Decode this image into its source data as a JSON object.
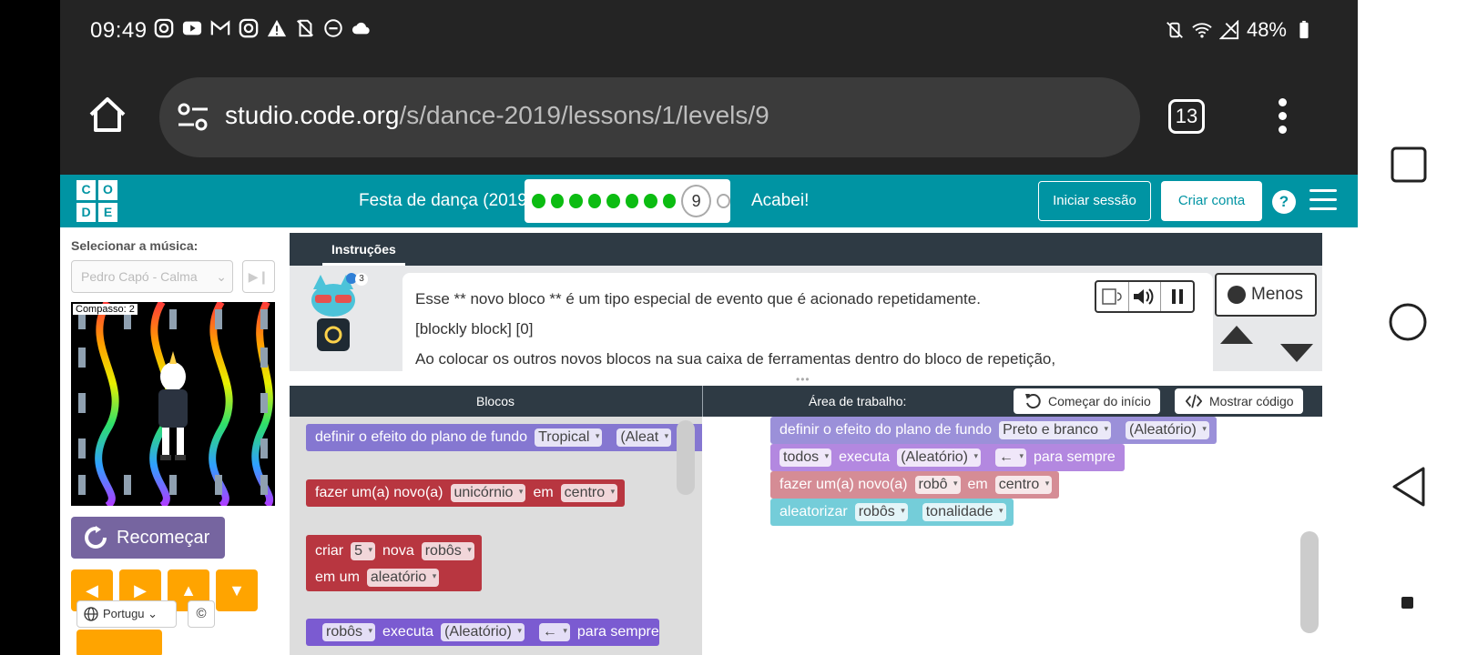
{
  "status_bar": {
    "time": "09:49",
    "battery": "48%",
    "left_icons": [
      "instagram-icon",
      "youtube-icon",
      "gmail-icon",
      "instagram-icon",
      "warning-icon",
      "data-saver-off-icon",
      "dnd-icon",
      "cloud-icon"
    ],
    "right_icons": [
      "vibrate-icon",
      "wifi-icon",
      "signal-icon",
      "battery-icon"
    ]
  },
  "browser": {
    "url_domain": "studio.code.org",
    "url_path": "/s/dance-2019/lessons/1/levels/9",
    "tab_count": "13"
  },
  "header": {
    "logo_letters": [
      "C",
      "O",
      "D",
      "E"
    ],
    "lesson_title": "Festa de dança (2019)",
    "completed_levels": 8,
    "current_level": "9",
    "finish_label": "Acabei!",
    "login_label": "Iniciar sessão",
    "create_account_label": "Criar conta",
    "help_label": "?"
  },
  "music": {
    "label": "Selecionar a música:",
    "selected": "Pedro Capó - Calma",
    "beat_label": "Compasso: 2"
  },
  "controls": {
    "restart_label": "Recomeçar",
    "arrows": [
      "◀",
      "▶",
      "▲",
      "▼"
    ],
    "language": "Portugu",
    "copyright": "©"
  },
  "instructions": {
    "tab_label": "Instruções",
    "hint_count": "3",
    "lines": [
      "Esse ** novo bloco ** é um tipo especial de evento que é acionado repetidamente.",
      "[blockly block] [0]",
      "Ao colocar os outros novos blocos na sua caixa de ferramentas dentro do bloco de repetição,"
    ],
    "less_label": "Menos"
  },
  "workspace_header": {
    "blocks_title": "Blocos",
    "workspace_title": "Área de trabalho:",
    "restart_label": "Começar do início",
    "show_code_label": "Mostrar código"
  },
  "toolbox_blocks": {
    "b1": {
      "text": "definir o efeito do plano de fundo",
      "f1": "Tropical",
      "f2": "(Aleat"
    },
    "b2": {
      "t1": "fazer um(a) novo(a)",
      "f1": "unicórnio",
      "t2": "em",
      "f2": "centro"
    },
    "b3": {
      "t1": "criar",
      "f1": "5",
      "t2": "nova",
      "f2": "robôs",
      "t3": "em um",
      "f3": "aleatório"
    },
    "b4": {
      "f1": "robôs",
      "t1": "executa",
      "f2": "(Aleatório)",
      "f3": "←",
      "t2": "para sempre"
    }
  },
  "workspace_blocks": {
    "w1": {
      "text": "definir o efeito do plano de fundo",
      "f1": "Preto e branco",
      "f2": "(Aleatório)"
    },
    "w2": {
      "f1": "todos",
      "t1": "executa",
      "f2": "(Aleatório)",
      "f3": "←",
      "t2": "para sempre"
    },
    "w3": {
      "t1": "fazer um(a) novo(a)",
      "f1": "robô",
      "t2": "em",
      "f2": "centro"
    },
    "w4": {
      "t1": "aleatorizar",
      "f1": "robôs",
      "f2": "tonalidade"
    }
  },
  "colors": {
    "teal_header": "#0094a3",
    "progress_green": "#0cbc12",
    "restart_purple": "#7665a0",
    "arrow_orange": "#ffa400"
  }
}
